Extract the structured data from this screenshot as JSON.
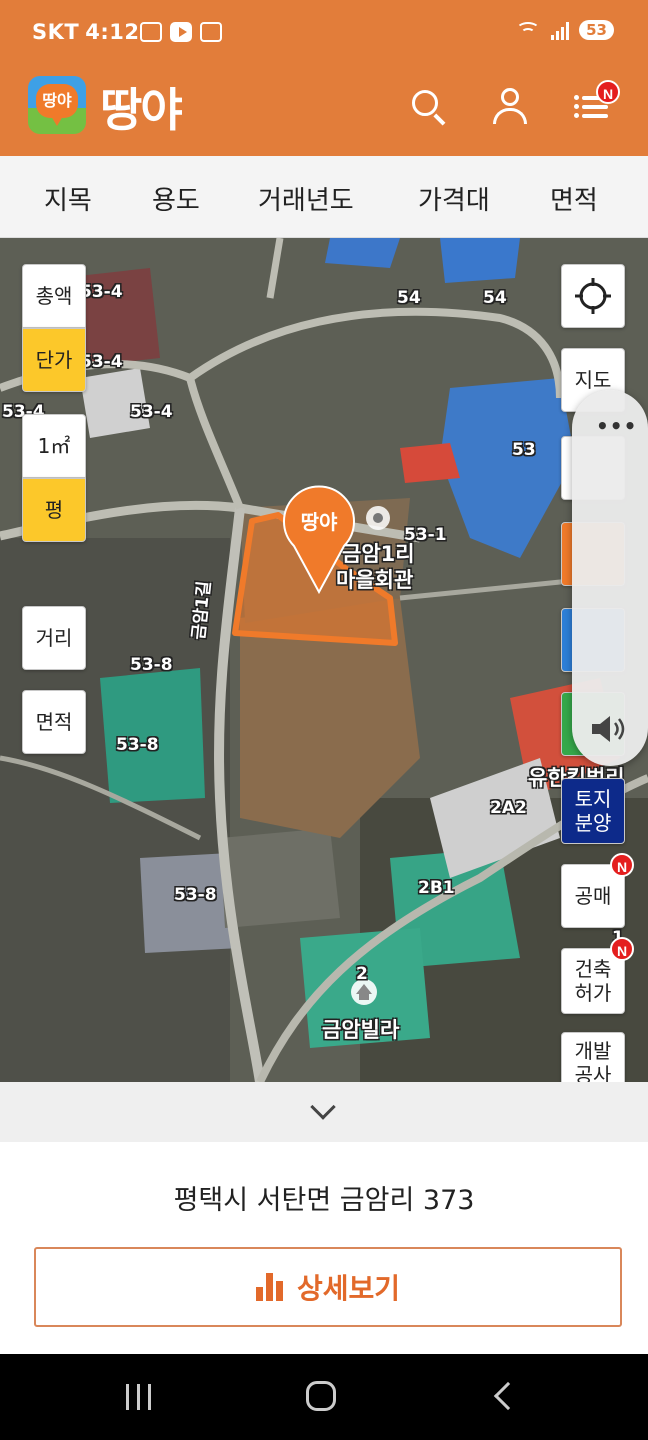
{
  "status_bar": {
    "carrier": "SKT",
    "time": "4:12",
    "battery": "53"
  },
  "header": {
    "logo_text": "땅야",
    "logo_badge_text": "땅야",
    "menu_badge": "N"
  },
  "filters": [
    "지목",
    "용도",
    "거래년도",
    "가격대",
    "면적"
  ],
  "left_controls": {
    "price_total": "총액",
    "price_unit": "단가",
    "unit_m2": "1㎡",
    "unit_pyeong": "평",
    "distance": "거리",
    "area": "면적"
  },
  "right_controls": {
    "map_type": "지도",
    "land_sale_line1": "토지",
    "land_sale_line2": "분양",
    "auction": "공매",
    "auction_badge": "N",
    "building_permit_line1": "건축",
    "building_permit_line2": "허가",
    "building_permit_badge": "N",
    "development_line1": "개발",
    "development_line2": "공사"
  },
  "map": {
    "marker_text": "땅야",
    "labels": {
      "l1": "53-4",
      "l2": "53-4",
      "l3": "53-4",
      "l4": "53-4",
      "l5": "54",
      "l6": "54",
      "l7": "53",
      "l8": "53-1",
      "l9": "53-8",
      "l10": "53-8",
      "l11": "53-8",
      "l12": "2A2",
      "l13": "2B1",
      "l14": "2",
      "road": "금암1길",
      "hall_line1": "금암1리",
      "hall_line2": "마을회관",
      "villa_apt": "유한킴벌리",
      "villa": "금암빌라",
      "edge": "1"
    }
  },
  "volume_panel": {
    "dots": "•••"
  },
  "bottom": {
    "address": "평택시 서탄면 금암리 373",
    "detail_label": "상세보기"
  },
  "colors": {
    "brand": "#e27d3a",
    "accent_yellow": "#fcc82a",
    "badge_red": "#e41e1e",
    "navy": "#0d2a8a"
  }
}
